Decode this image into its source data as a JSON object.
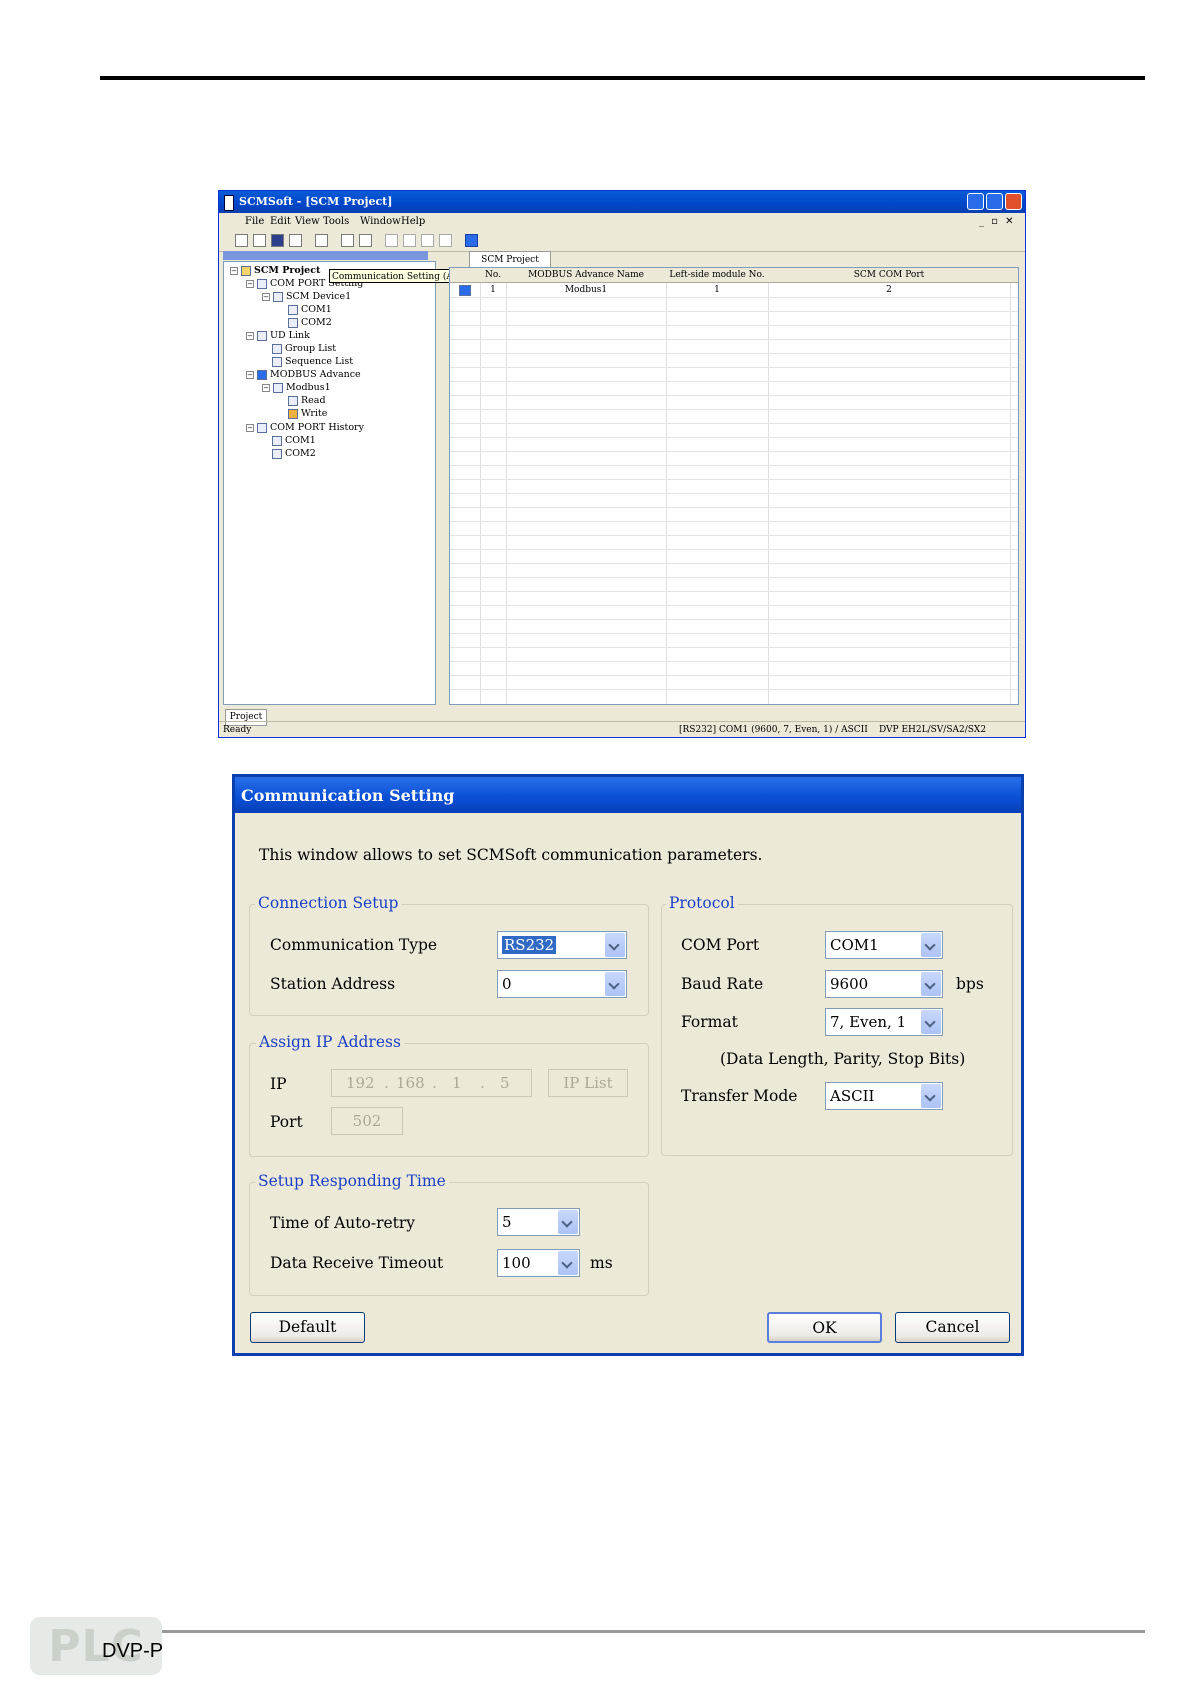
{
  "app": {
    "title": "SCMSoft - [SCM Project]",
    "menu": [
      "File",
      "Edit",
      "View",
      "Tools",
      "Window",
      "Help"
    ],
    "tooltip": "Communication Setting (Alt + S)",
    "doc_tab": "SCM Project",
    "project_tab": "Project",
    "tree": {
      "root": "SCM Project",
      "com_port_setting": "COM PORT Setting",
      "scm_device": "SCM Device1",
      "com1": "COM1",
      "com2": "COM2",
      "ud_link": "UD Link",
      "group_list": "Group List",
      "sequence_list": "Sequence List",
      "modbus_advance": "MODBUS Advance",
      "modbus1": "Modbus1",
      "read": "Read",
      "write": "Write",
      "com_port_history": "COM PORT History",
      "hist_com1": "COM1",
      "hist_com2": "COM2"
    },
    "grid": {
      "columns": [
        "No.",
        "MODBUS Advance Name",
        "Left-side module No.",
        "SCM COM Port"
      ],
      "rows": [
        {
          "no": "1",
          "name": "Modbus1",
          "left_module": "1",
          "com_port": "2"
        }
      ]
    },
    "status": {
      "left": "Ready",
      "middle": "[RS232] COM1 (9600, 7, Even, 1) / ASCII",
      "right": "DVP EH2L/SV/SA2/SX2"
    }
  },
  "dialog": {
    "title": "Communication Setting",
    "description": "This window allows to set  SCMSoft communication parameters.",
    "connection_setup": {
      "label": "Connection Setup",
      "type_label": "Communication Type",
      "type_value": "RS232",
      "station_label": "Station Address",
      "station_value": "0"
    },
    "assign_ip": {
      "label": "Assign IP Address",
      "ip_label": "IP",
      "ip": [
        "192",
        "168",
        "1",
        "5"
      ],
      "ip_list_button": "IP List",
      "port_label": "Port",
      "port_value": "502"
    },
    "responding": {
      "label": "Setup Responding Time",
      "retry_label": "Time of Auto-retry",
      "retry_value": "5",
      "timeout_label": "Data Receive Timeout",
      "timeout_value": "100",
      "timeout_unit": "ms"
    },
    "protocol": {
      "label": "Protocol",
      "com_port_label": "COM Port",
      "com_port_value": "COM1",
      "baud_label": "Baud Rate",
      "baud_value": "9600",
      "baud_unit": "bps",
      "format_label": "Format",
      "format_value": "7, Even, 1",
      "format_hint": "(Data Length, Parity, Stop Bits)",
      "transfer_label": "Transfer Mode",
      "transfer_value": "ASCII"
    },
    "buttons": {
      "default": "Default",
      "ok": "OK",
      "cancel": "Cancel"
    }
  },
  "footer": {
    "logo": "PLC",
    "text": "DVP-P"
  }
}
